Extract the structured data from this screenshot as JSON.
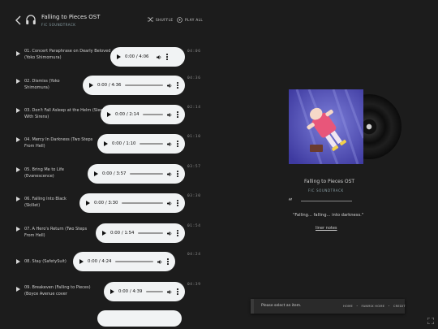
{
  "header": {
    "title": "Falling to Pieces OST",
    "subtitle": "FIC SOUNDTRACK",
    "shuffle_label": "SHUFFLE",
    "playall_label": "PLAY ALL"
  },
  "tracks": [
    {
      "name": "01. Concert Paraphrase on Dearly Beloved (Yoko Shimomura)",
      "time": "0:00 / 4:06",
      "duration": "04:06"
    },
    {
      "name": "02. Dismiss (Yoko Shimomura)",
      "time": "0:00 / 4:36",
      "duration": "04:36"
    },
    {
      "name": "03. Don't Fall Asleep at the Helm (Sleeping With Sirens)",
      "time": "0:00 / 2:14",
      "duration": "02:14"
    },
    {
      "name": "04. Mercy In Darkness (Two Steps From Hell)",
      "time": "0:00 / 1:10",
      "duration": "01:10"
    },
    {
      "name": "05. Bring Me to Life (Evanescence)",
      "time": "0:00 / 3:57",
      "duration": "03:57"
    },
    {
      "name": "06. Falling Into Black (Skillet)",
      "time": "0:00 / 3:30",
      "duration": "03:30"
    },
    {
      "name": "07. A Hero's Return (Two Steps From Hell)",
      "time": "0:00 / 1:54",
      "duration": "01:54"
    },
    {
      "name": "08. Stay (SafetySuit)",
      "time": "0:00 / 4:24",
      "duration": "04:24"
    },
    {
      "name": "09. Breakeven (Falling to Pieces) (Boyce Avenue cover",
      "time": "0:00 / 4:39",
      "duration": "04:39"
    }
  ],
  "panel": {
    "album_title": "Falling to Pieces OST",
    "album_subtitle": "FIC SOUNDTRACK",
    "quote_mark": "“",
    "quote": "\"Falling... falling... into darkness.\"",
    "liner_notes": "liner notes"
  },
  "status": {
    "message": "Please select an item.",
    "crumbs": [
      "HOME",
      "FANMIX HOME",
      "CREDIT"
    ],
    "separator": "•"
  },
  "icons": {
    "back": "chevron-left-icon",
    "headphones": "headphones-icon",
    "shuffle": "shuffle-icon",
    "playall": "play-circle-icon",
    "expand": "expand-icon"
  }
}
